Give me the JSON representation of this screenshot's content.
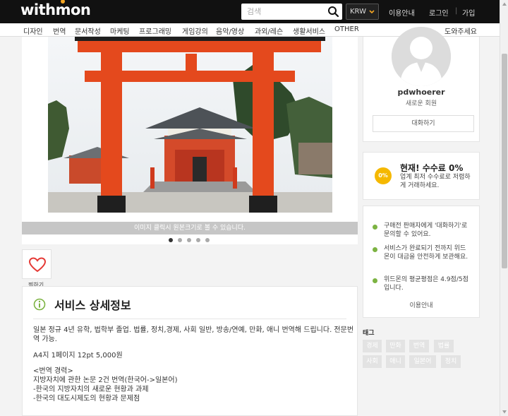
{
  "header": {
    "logo": "withmon",
    "search_placeholder": "검색",
    "currency": "KRW",
    "nav": {
      "guide": "이용안내",
      "login": "로그인",
      "join": "가입"
    }
  },
  "categories": [
    "디자인",
    "번역",
    "문서작성",
    "마케팅",
    "프로그래밍",
    "게임강의",
    "음악/영상",
    "과외/레슨",
    "생활서비스",
    "OTHER"
  ],
  "category_help": "도와주세요",
  "gallery": {
    "caption": "이미지 클릭시 원본크기로 볼 수 있습니다.",
    "dots": 5,
    "active_dot": 0
  },
  "like": {
    "label": "찜하기"
  },
  "detail": {
    "title": "서비스 상세정보",
    "lines": [
      "일본 정규 4년 유학, 법학부 졸업. 법률, 정치,경제, 사회 일반, 방송/연예, 만화, 애니 번역해 드립니다. 전문번",
      "역 가능.",
      "A4지 1페이지 12pt 5,000원",
      "<번역 경력>",
      "지방자치에 관한 논문 2건 번역(한국어->일본어)",
      "-한국의 지방자치의 새로운 현황과 과제",
      "-한국의 대도시제도의 현황과 문제점"
    ]
  },
  "profile": {
    "username": "pdwhoerer",
    "member_type": "새로운 회원",
    "chat_button": "대화하기"
  },
  "fee": {
    "badge": "0%",
    "title": "현재! 수수료 0%",
    "desc": "업계 최저 수수료로 저렴하게 거래하세요."
  },
  "info": {
    "items": [
      "구매전 판매자에게 '대화하기'로 문의할 수 있어요.",
      "서비스가 완료되기 전까지 위드몬이 대금을 안전하게 보관해요.",
      "위드몬의 평균평점은 4.9점/5점 입니다."
    ],
    "link": "이용안내"
  },
  "tags": {
    "title": "태그",
    "items": [
      "경제",
      "만화",
      "번역",
      "법률",
      "사회",
      "애니",
      "일본어",
      "정치"
    ]
  },
  "colors": {
    "accent": "#f5b800",
    "bullet": "#7cb342",
    "like": "#e53935"
  }
}
